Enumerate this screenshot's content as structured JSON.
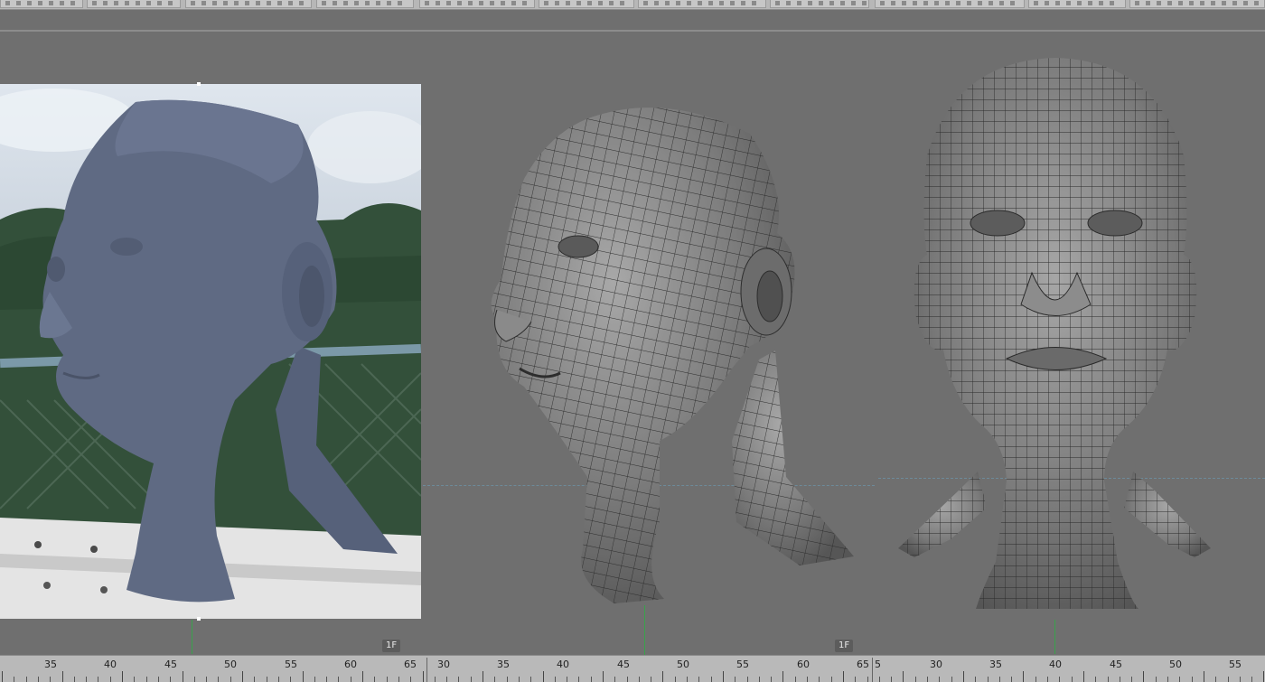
{
  "toolbar": {
    "icons": "toolbar-icon"
  },
  "viewport": {
    "frame_labels": [
      "1F",
      "1F"
    ]
  },
  "ruler": {
    "segments": [
      {
        "labels": [
          "35",
          "40",
          "45",
          "50",
          "55",
          "60",
          "65"
        ]
      },
      {
        "labels": [
          "30",
          "35",
          "40",
          "45",
          "50",
          "55",
          "60",
          "65"
        ]
      },
      {
        "labels": [
          "5",
          "30",
          "35",
          "40",
          "45",
          "50",
          "55"
        ]
      }
    ]
  },
  "colors": {
    "viewport_bg": "#6f6f6f",
    "ruler_bg": "#b9b9b9",
    "pivot_line": "#39a24b",
    "head_shaded": "#5f6a83",
    "mesh_face": "#7a7a7a"
  }
}
